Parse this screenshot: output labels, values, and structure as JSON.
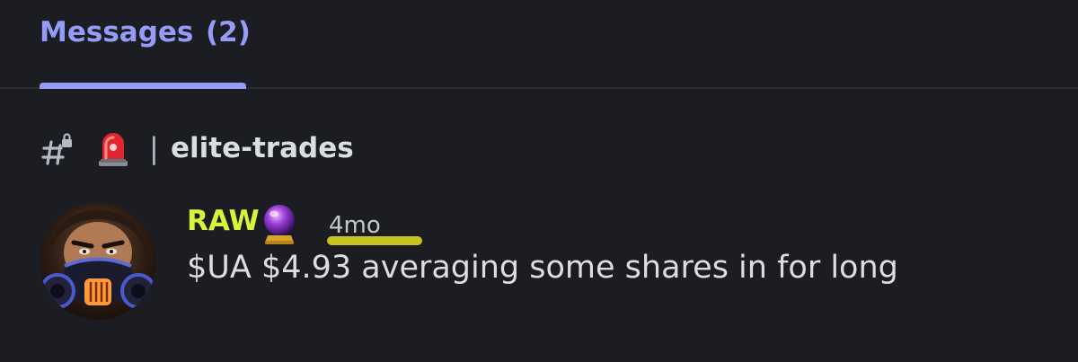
{
  "tabs": {
    "messages_label": "Messages",
    "messages_count": "(2)"
  },
  "channel": {
    "icon": "hash-lock-icon",
    "emoji": "siren-icon",
    "separator": "|",
    "name": "elite-trades"
  },
  "message": {
    "author": "RAW",
    "author_color": "#d7f33a",
    "badge_icon": "crystal-ball-icon",
    "timestamp": "4mo",
    "content": "$UA $4.93 averaging some shares in for long"
  },
  "colors": {
    "background": "#1c1d22",
    "accent": "#949cf7",
    "highlight": "#c7c222"
  }
}
